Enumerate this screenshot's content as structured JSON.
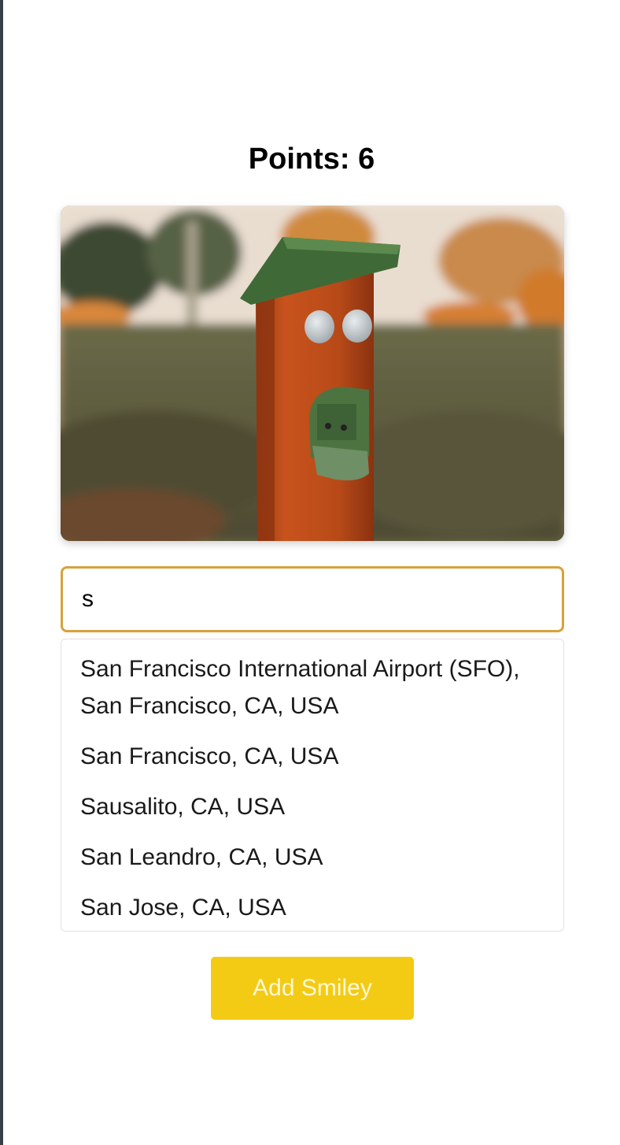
{
  "header": {
    "points_text": "Points: 6"
  },
  "photo": {
    "description_icon": "birdhouse-face-photo"
  },
  "search": {
    "value": "s"
  },
  "suggestions": [
    "San Francisco International Airport (SFO), San Francisco, CA, USA",
    "San Francisco, CA, USA",
    "Sausalito, CA, USA",
    "San Leandro, CA, USA",
    "San Jose, CA, USA"
  ],
  "actions": {
    "add_label": "Add Smiley"
  },
  "colors": {
    "accent_border": "#d8a23a",
    "button_bg": "#f3cb14",
    "button_text": "#fff8d6"
  }
}
